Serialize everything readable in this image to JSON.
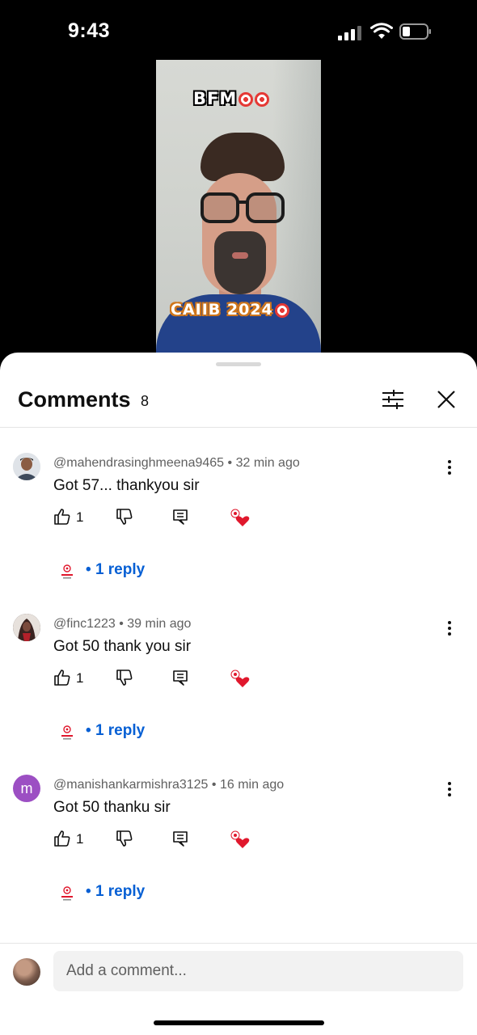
{
  "status_bar": {
    "time": "9:43"
  },
  "video": {
    "overlay_top": "BFM",
    "overlay_bottom": "CAIIB 2024"
  },
  "comments_sheet": {
    "title": "Comments",
    "count": "8",
    "comments": [
      {
        "author": "@mahendrasinghmeena9465",
        "time": "32 min ago",
        "text": "Got 57... thankyou sir",
        "likes": "1",
        "replies": "1 reply"
      },
      {
        "author": "@finc1223",
        "time": "39 min ago",
        "text": "Got 50 thank you sir",
        "likes": "1",
        "replies": "1 reply"
      },
      {
        "author": "@manishankarmishra3125",
        "time": "16 min ago",
        "text": "Got 50 thanku sir",
        "likes": "1",
        "replies": "1 reply",
        "avatar_letter": "m"
      }
    ],
    "composer": {
      "placeholder": "Add a comment..."
    },
    "separator": "•"
  },
  "colors": {
    "link": "#065fd4",
    "heart": "#e0182d",
    "avatar_m": "#9c4fc3"
  },
  "icons": [
    "thumb-up-icon",
    "thumb-down-icon",
    "reply-icon",
    "heart-icon",
    "filter-icon",
    "close-icon",
    "more-vert-icon"
  ]
}
